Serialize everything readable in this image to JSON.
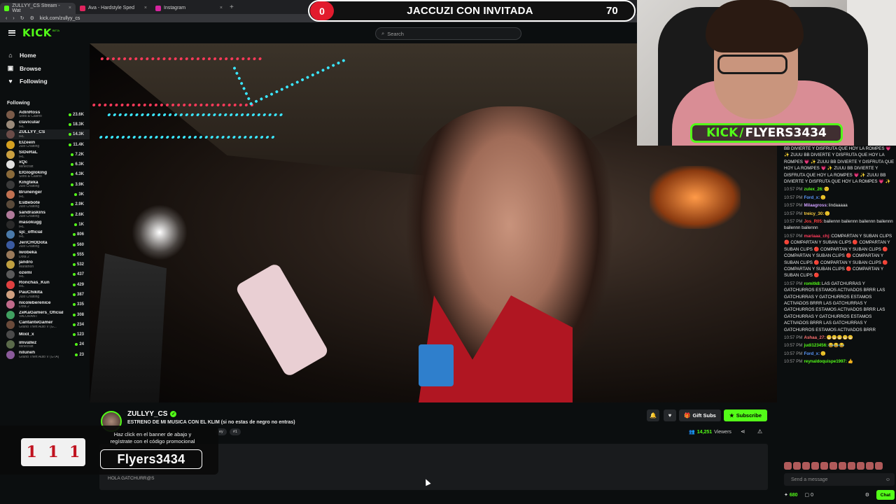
{
  "browser": {
    "tabs": [
      {
        "label": "ZULLYY_CS Stream - Wat",
        "color": "#53fc18",
        "active": true
      },
      {
        "label": "Ava - Hardstyle Sped",
        "color": "#e0245e",
        "active": false
      },
      {
        "label": "Instagram",
        "color": "#d6249f",
        "active": false
      }
    ],
    "new_tab": "+",
    "url": "kick.com/zullyy_cs"
  },
  "header": {
    "logo": "KICK",
    "logo_beta": "BETA",
    "search_placeholder": "Search"
  },
  "sidebar": {
    "nav": [
      {
        "label": "Home",
        "icon": "⌂"
      },
      {
        "label": "Browse",
        "icon": "▣"
      },
      {
        "label": "Following",
        "icon": "♥"
      }
    ],
    "following_title": "Following",
    "channels": [
      {
        "name": "AdinRoss",
        "category": "Slots & Casino",
        "viewers": "23.6K",
        "color": "#7a5a48"
      },
      {
        "name": "clavicular",
        "category": "IRL",
        "viewers": "18.3K",
        "color": "#9a8a7a"
      },
      {
        "name": "ZULLYY_CS",
        "category": "IRL",
        "viewers": "14.3K",
        "color": "#6b4c48",
        "active": true
      },
      {
        "name": "ElZeein",
        "category": "Just Chatting",
        "viewers": "11.4K",
        "color": "#d4a020"
      },
      {
        "name": "SiDeRaL",
        "category": "IRL",
        "viewers": "7.2K",
        "color": "#caa040"
      },
      {
        "name": "xQc",
        "category": "Minecraft",
        "viewers": "6.3K",
        "color": "#e0e0e0"
      },
      {
        "name": "ElGlogloking",
        "category": "Slots & Casino",
        "viewers": "4.3K",
        "color": "#8a6a3a"
      },
      {
        "name": "Kingteka",
        "category": "Just Chatting",
        "viewers": "3.9K",
        "color": "#3a3a3a"
      },
      {
        "name": "Brunenger",
        "category": "IRL",
        "viewers": "3K",
        "color": "#c07050"
      },
      {
        "name": "EsBebote",
        "category": "Just Chatting",
        "viewers": "2.9K",
        "color": "#5a4a3a"
      },
      {
        "name": "sandraskins",
        "category": "Just Chatting",
        "viewers": "2.6K",
        "color": "#b07a9a"
      },
      {
        "name": "masokugg",
        "category": "IRL",
        "viewers": "1K",
        "color": "#2a2a2a"
      },
      {
        "name": "sjc_official",
        "category": "IRL",
        "viewers": "806",
        "color": "#4a7aaa"
      },
      {
        "name": "JeriCHODota",
        "category": "Just Chatting",
        "viewers": "560",
        "color": "#3a5aa0"
      },
      {
        "name": "iwobeka",
        "category": "Dota 2",
        "viewers": "555",
        "color": "#9a7a5a"
      },
      {
        "name": "jandro",
        "category": "Marathon",
        "viewers": "532",
        "color": "#c0a040"
      },
      {
        "name": "ozemi",
        "category": "IRL",
        "viewers": "437",
        "color": "#5a5a5a"
      },
      {
        "name": "Ronchas_Kun",
        "category": "IRL",
        "viewers": "429",
        "color": "#e04040"
      },
      {
        "name": "PauChikita",
        "category": "Just Chatting",
        "viewers": "387",
        "color": "#d0a080"
      },
      {
        "name": "nicoleberenice",
        "category": "Dota 2",
        "viewers": "335",
        "color": "#c06a8a"
      },
      {
        "name": "ZeKaGamers_Oficial",
        "category": "VALORANT",
        "viewers": "308",
        "color": "#40a060"
      },
      {
        "name": "CantanteGamer",
        "category": "Grand Theft Auto V (G...",
        "viewers": "234",
        "color": "#6a4a3a"
      },
      {
        "name": "Mixil_x",
        "category": "",
        "viewers": "123",
        "color": "#4a4a4a"
      },
      {
        "name": "imvallez",
        "category": "Minecraft",
        "viewers": "24",
        "color": "#5a6a4a"
      },
      {
        "name": "niluneh",
        "category": "Grand Theft Auto V (GTA)",
        "viewers": "23",
        "color": "#8a5a9a"
      }
    ]
  },
  "scoreboard": {
    "left_score": "0",
    "title": "JACCUZI CON INVITADA",
    "right_score": "70"
  },
  "webcam": {
    "badge_kick": "KICK",
    "badge_name": "FLYERS3434"
  },
  "channel": {
    "name": "ZULLYY_CS",
    "title": "ESTRENO DE MI MUSICA CON EL KLIM (si no estas de negro no entras)",
    "tags": [
      "ey",
      "#1"
    ],
    "gift_label": "Gift Subs",
    "subscribe_label": "Subscribe",
    "viewers": "14,251",
    "viewers_suffix": "Viewers"
  },
  "about": {
    "text": "HOLA GATCHURR@S"
  },
  "promo": {
    "slot_symbols": [
      "1",
      "1",
      "1"
    ],
    "text_line1": "Haz click en el banner de abajo  y",
    "text_line2": "regístrate con el código promocional",
    "code": "Flyers3434"
  },
  "chat": {
    "messages": [
      {
        "time": "",
        "user": "",
        "color": "#ffffff",
        "text": "BB DIVIERTE Y DISFRUTA QUE HOY LA ROMPES 💗 ✨ ZUUU BB DIVIERTE Y DISFRUTA QUE HOY LA ROMPES 💗 ✨ ZUUU BB DIVIERTE Y DISFRUTA QUE HOY LA ROMPES 💗 ✨ ZUUU BB DIVIERTE Y DISFRUTA QUE HOY LA ROMPES 💗 ✨ ZUUU BB DIVIERTE Y DISFRUTA QUE HOY LA ROMPES 💗 ✨"
      },
      {
        "time": "10:57 PM",
        "user": "zulex_26:",
        "color": "#53fc18",
        "text": "🙂"
      },
      {
        "time": "10:57 PM",
        "user": "Ford_x:",
        "color": "#5a9aff",
        "text": "🙂"
      },
      {
        "time": "10:57 PM",
        "user": "Milaagross:",
        "color": "#d0a0ff",
        "text": "lindaaaaa"
      },
      {
        "time": "10:57 PM",
        "user": "treicy_30:",
        "color": "#ffd040",
        "text": "🙂"
      },
      {
        "time": "10:57 PM",
        "user": "Jos_R05:",
        "color": "#ff4040",
        "text": "bailennn bailennn bailennn bailennn bailennn bailennn"
      },
      {
        "time": "10:57 PM",
        "user": "mariaaa_chj:",
        "color": "#ff3a5a",
        "text": "COMPARTAN Y SUBAN CLIPS 🔴 COMPARTAN Y SUBAN CLIPS 🔴 COMPARTAN Y SUBAN CLIPS 🔴 COMPARTAN Y SUBAN CLIPS 🔴 COMPARTAN Y SUBAN CLIPS 🔴 COMPARTAN Y SUBAN CLIPS 🔴 COMPARTAN Y SUBAN CLIPS 🔴 COMPARTAN Y SUBAN CLIPS 🔴 COMPARTAN Y SUBAN CLIPS 🔴"
      },
      {
        "time": "10:57 PM",
        "user": "romitk8:",
        "color": "#53fc18",
        "text": "LAS GATCHURRAS Y GATCHURROS ESTAMOS ACTIVADOS BRRR LAS GATCHURRAS Y GATCHURROS ESTAMOS ACTIVADOS BRRR LAS GATCHURRAS Y GATCHURROS ESTAMOS ACTIVADOS BRRR LAS GATCHURRAS Y GATCHURROS ESTAMOS ACTIVADOS BRRR LAS GATCHURRAS Y GATCHURROS ESTAMOS ACTIVADOS BRRR"
      },
      {
        "time": "10:57 PM",
        "user": "Ashaa_27:",
        "color": "#ff7070",
        "text": "😁😁😁😁😁"
      },
      {
        "time": "10:57 PM",
        "user": "judi123456:",
        "color": "#53fc18",
        "text": "😂😂😂"
      },
      {
        "time": "10:57 PM",
        "user": "Ford_x:",
        "color": "#5a9aff",
        "text": "🙂"
      },
      {
        "time": "10:57 PM",
        "user": "reynaldoquispe1997:",
        "color": "#53fc18",
        "text": "👍"
      }
    ],
    "input_placeholder": "Send a message",
    "points": "680",
    "count": "0",
    "chat_button": "Chat"
  },
  "colors": {
    "accent": "#53fc18",
    "background": "#0b0e0f",
    "score_red": "#e21b2d"
  }
}
